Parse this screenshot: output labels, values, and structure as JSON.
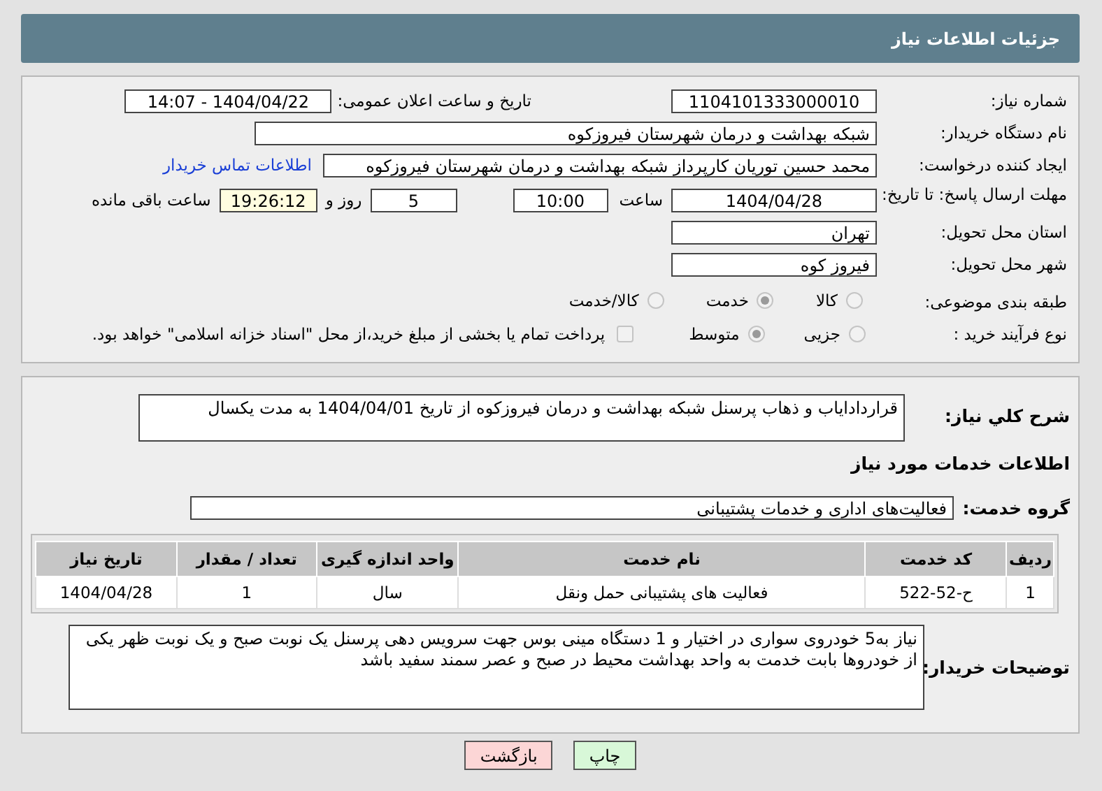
{
  "header": {
    "title": "جزئیات اطلاعات نیاز"
  },
  "need_number": {
    "label": "شماره نیاز:",
    "value": "1104101333000010"
  },
  "announce": {
    "label": "تاریخ و ساعت اعلان عمومی:",
    "value": "1404/04/22 - 14:07"
  },
  "buyer_org": {
    "label": "نام دستگاه خریدار:",
    "value": "شبکه بهداشت و درمان شهرستان فیروزکوه"
  },
  "requester": {
    "label": "ایجاد کننده درخواست:",
    "value": "محمد حسین توریان کارپرداز شبکه بهداشت و درمان شهرستان فیروزکوه",
    "link": "اطلاعات تماس خریدار"
  },
  "deadline": {
    "label": "مهلت ارسال پاسخ: تا تاریخ:",
    "date": "1404/04/28",
    "time_label": "ساعت",
    "time": "10:00",
    "days": "5",
    "days_label": "روز و",
    "remaining": "19:26:12",
    "remaining_label": "ساعت باقی مانده"
  },
  "province": {
    "label": "استان محل تحویل:",
    "value": "تهران"
  },
  "city": {
    "label": "شهر محل تحویل:",
    "value": "فیروز کوه"
  },
  "category": {
    "label": "طبقه بندی موضوعی:",
    "options": [
      {
        "label": "کالا",
        "selected": false
      },
      {
        "label": "خدمت",
        "selected": true
      },
      {
        "label": "کالا/خدمت",
        "selected": false
      }
    ]
  },
  "process": {
    "label": "نوع فرآیند خرید :",
    "options": [
      {
        "label": "جزیی",
        "selected": false
      },
      {
        "label": "متوسط",
        "selected": true
      }
    ],
    "payment": {
      "checked": false,
      "text": "پرداخت تمام یا بخشی از مبلغ خرید،از محل \"اسناد خزانه اسلامی\" خواهد بود."
    }
  },
  "description": {
    "label": "شرح کلي نياز:",
    "value": "قراردادایاب و ذهاب پرسنل شبکه بهداشت و درمان فیروزکوه از تاریخ 1404/04/01 به مدت یکسال"
  },
  "services_heading": "اطلاعات خدمات مورد نیاز",
  "service_group": {
    "label": "گروه خدمت:",
    "value": "فعالیت‌های اداری و خدمات پشتیبانی"
  },
  "table": {
    "columns": [
      "ردیف",
      "کد خدمت",
      "نام خدمت",
      "واحد اندازه گیری",
      "تعداد / مقدار",
      "تاریخ نیاز"
    ],
    "rows": [
      [
        "1",
        "ح-52-522",
        "فعالیت های پشتیبانی حمل ونقل",
        "سال",
        "1",
        "1404/04/28"
      ]
    ]
  },
  "buyer_notes": {
    "label": "توضیحات خریدار:",
    "value": "نیاز به5 خودروی سواری در اختیار و 1 دستگاه مینی بوس جهت سرویس دهی پرسنل یک نوبت صبح و یک نوبت ظهر یکی از خودروها بابت خدمت به واحد بهداشت محیط در صبح و عصر سمند سفید باشد"
  },
  "buttons": [
    {
      "label": "چاپ",
      "kind": "print"
    },
    {
      "label": "بازگشت",
      "kind": "back"
    }
  ]
}
